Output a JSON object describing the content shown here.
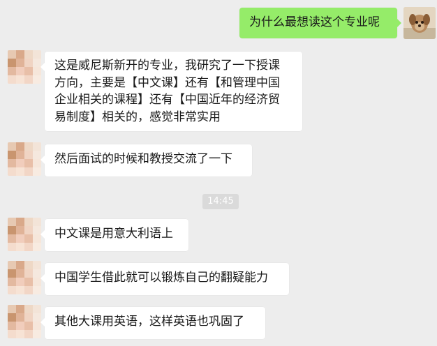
{
  "messages": [
    {
      "id": "m1",
      "side": "outgoing",
      "text": "为什么最想读这个专业呢"
    },
    {
      "id": "m2",
      "side": "incoming",
      "lines": [
        "这是威尼斯新开的专业，我研究了一下授课",
        "方向，主要是【中文课】还有【和管理中国",
        "企业相关的课程】还有【中国近年的经济贸",
        "易制度】相关的，感觉非常实用"
      ]
    },
    {
      "id": "m3",
      "side": "incoming",
      "text": "然后面试的时候和教授交流了一下"
    },
    {
      "id": "m4",
      "side": "incoming",
      "text": "中文课是用意大利语上"
    },
    {
      "id": "m5",
      "side": "incoming",
      "text": "中国学生借此就可以锻炼自己的翻疑能力"
    },
    {
      "id": "m6",
      "side": "incoming",
      "text": "其他大课用英语，这样英语也巩固了"
    }
  ],
  "timestamp": "14:45",
  "colors": {
    "background": "#ededed",
    "outgoing_bubble": "#95ec69",
    "incoming_bubble": "#ffffff",
    "timestamp_bg": "#dadada"
  }
}
